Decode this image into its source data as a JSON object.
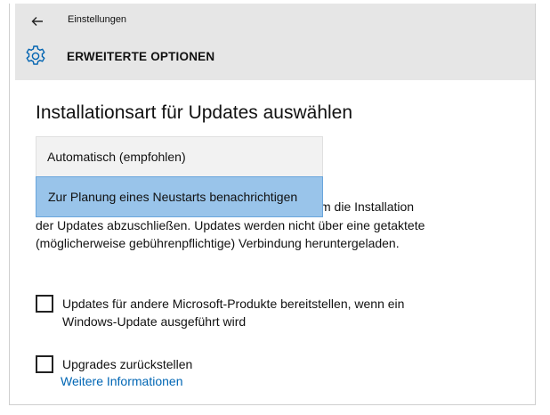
{
  "window": {
    "app_title": "Einstellungen",
    "back_icon": "back-arrow-icon",
    "header_icon": "gear-icon"
  },
  "header": {
    "title": "ERWEITERTE OPTIONEN"
  },
  "install_section": {
    "title": "Installationsart für Updates auswählen",
    "dropdown": {
      "options": [
        "Automatisch (empfohlen)",
        "Zur Planung eines Neustarts benachrichtigen"
      ],
      "highlighted_option": "Zur Planung eines Neustarts benachrichtigen",
      "highlight_color": "#99c4ea"
    },
    "description_line1": "m die Installation",
    "description_rest": "der Updates abzuschließen. Updates werden nicht über eine getaktete (möglicherweise gebührenpflichtige) Verbindung heruntergeladen."
  },
  "options": {
    "other_products_label": "Updates für andere Microsoft-Produkte bereitstellen, wenn ein Windows-Update ausgeführt wird",
    "other_products_checked": false,
    "defer_upgrades_label": "Upgrades zurückstellen",
    "defer_upgrades_checked": false,
    "more_info_link": "Weitere Informationen"
  },
  "colors": {
    "accent": "#0066b4",
    "titlebar_bg": "#e6e6e6",
    "gear_color": "#0063b1"
  }
}
